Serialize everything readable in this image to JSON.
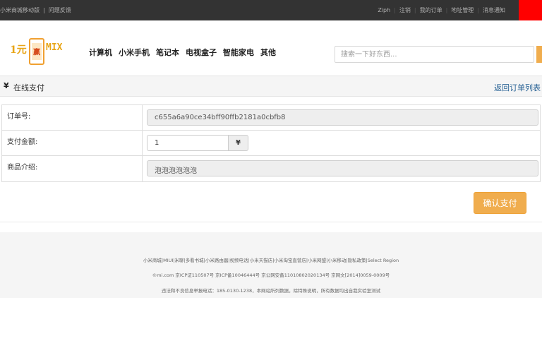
{
  "topbar": {
    "left_links": [
      "小米商城移动版",
      "问题反馈"
    ],
    "right_links": [
      "Ziph",
      "注销",
      "我的订单",
      "地址管理",
      "消息通知"
    ]
  },
  "header": {
    "logo": {
      "prefix": "1元",
      "center": "赢",
      "suffix": "MIX"
    },
    "nav": [
      "计算机",
      "小米手机",
      "笔记本",
      "电视盒子",
      "智能家电",
      "其他"
    ],
    "search_placeholder": "搜索一下好东西..."
  },
  "breadcrumb": {
    "icon": "yen-icon",
    "icon_glyph": "¥",
    "title": "在线支付",
    "back_link": "返回订单列表"
  },
  "form": {
    "order_no_label": "订单号:",
    "order_no_value": "c655a6a90ce34bff90ffb2181a0cbfb8",
    "amount_label": "支付金额:",
    "amount_value": "1",
    "currency_symbol": "¥",
    "desc_label": "商品介绍:",
    "desc_value": "泡泡泡泡泡泡"
  },
  "confirm_label": "确认支付",
  "footer": {
    "line1": "小米商城|MIUI|米聊|多看书城|小米路由器|视频电话|小米天猫店|小米淘宝直营店|小米网盟|小米移动|隐私政策|Select Region",
    "line2": "©mi.com 京ICP证110507号 京ICP备10046444号 京公网安备11010802020134号 京网文[2014]0059-0009号",
    "line3": "违法和不良信息举报电话：185-0130-1238，本网站所列数据，除特殊说明，所有数据均出自我实验室测试"
  },
  "colors": {
    "topbar": "#333333",
    "accent": "#f0ad4e",
    "cart": "#ff0000",
    "link": "#2a6496"
  }
}
